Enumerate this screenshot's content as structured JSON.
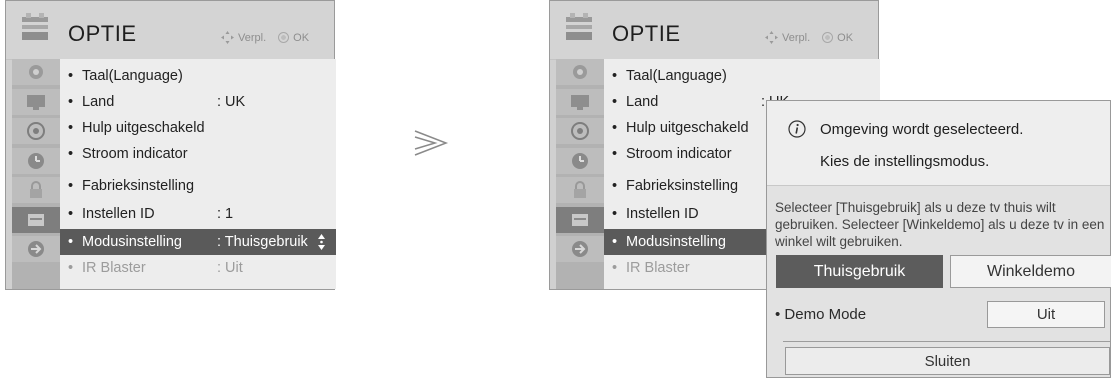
{
  "left_panel": {
    "title": "OPTIE",
    "hint_move": "Verpl.",
    "hint_ok": "OK",
    "rows": [
      {
        "label": "Taal(Language)",
        "value": ""
      },
      {
        "label": "Land",
        "value": ": UK"
      },
      {
        "label": "Hulp uitgeschakeld",
        "value": ""
      },
      {
        "label": "Stroom indicator",
        "value": ""
      },
      {
        "label": "Fabrieksinstelling",
        "value": ""
      },
      {
        "label": "Instellen ID",
        "value": ": 1"
      },
      {
        "label": "Modusinstelling",
        "value": ": Thuisgebruik"
      },
      {
        "label": "IR Blaster",
        "value": ": Uit"
      }
    ]
  },
  "right_panel": {
    "title": "OPTIE",
    "hint_move": "Verpl.",
    "hint_ok": "OK",
    "rows": [
      {
        "label": "Taal(Language)",
        "value": ""
      },
      {
        "label": "Land",
        "value": ": UK"
      },
      {
        "label": "Hulp uitgeschakeld",
        "value": ""
      },
      {
        "label": "Stroom indicator",
        "value": ""
      },
      {
        "label": "Fabrieksinstelling",
        "value": ""
      },
      {
        "label": "Instellen ID",
        "value": ""
      },
      {
        "label": "Modusinstelling",
        "value": ""
      },
      {
        "label": "IR Blaster",
        "value": ""
      }
    ]
  },
  "bullet": "•",
  "popup": {
    "info_line1": "Omgeving wordt geselecteerd.",
    "info_line2": "Kies de instellingsmodus.",
    "description": "Selecteer [Thuisgebruik] als u deze tv thuis wilt gebruiken. Selecteer [Winkeldemo] als u deze tv in een winkel wilt gebruiken.",
    "option_home": "Thuisgebruik",
    "option_shop": "Winkeldemo",
    "demo_label": "• Demo Mode",
    "demo_value": "Uit",
    "close_label": "Sluiten"
  },
  "colors": {
    "selected_row": "#5a5a5a",
    "panel_bg": "#d0d0d0",
    "menu_bg": "#ededed"
  }
}
